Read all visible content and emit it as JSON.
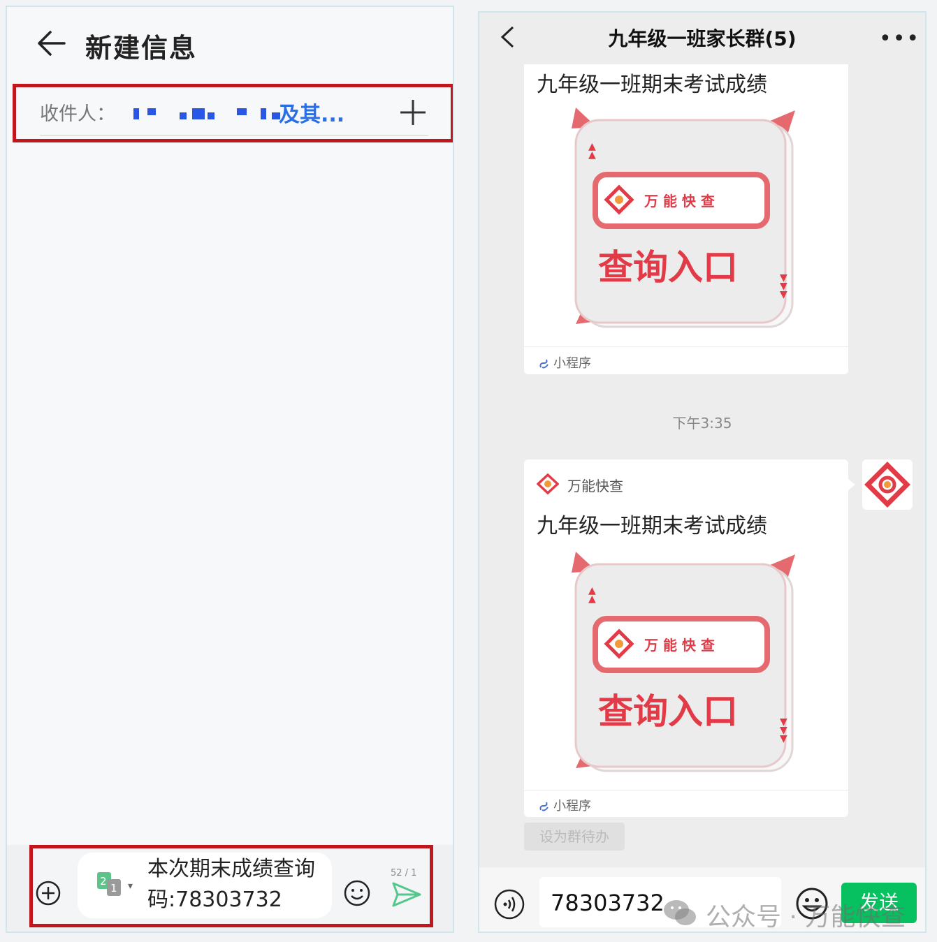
{
  "left": {
    "title": "新建信息",
    "recipient_label": "收件人：",
    "recipient_names": "及其...",
    "compose_text": "本次期末成绩查询码:78303732",
    "counter": "52 / 1"
  },
  "right": {
    "chat_title": "九年级一班家长群(5)",
    "card_title": "九年级一班期末考试成绩",
    "card_brand_text": "万 能 快 查",
    "card_main_text": "查询入口",
    "mini_program_label": "小程序",
    "timestamp": "下午3:35",
    "source_name": "万能快查",
    "todo_button": "设为群待办",
    "input_value": "78303732",
    "send_button": "发送"
  },
  "watermark": "公众号 · 万能快查",
  "colors": {
    "accent_red": "#e23a47",
    "wechat_green": "#07c160",
    "link_blue": "#2b6fe6",
    "highlight_box": "#c0161d"
  },
  "icons": [
    "back-arrow-icon",
    "plus-icon",
    "plus-circle-icon",
    "sim-card-icon",
    "emoji-icon",
    "send-icon",
    "chevron-left-icon",
    "more-icon",
    "voice-icon",
    "mini-program-icon",
    "wechat-icon"
  ]
}
